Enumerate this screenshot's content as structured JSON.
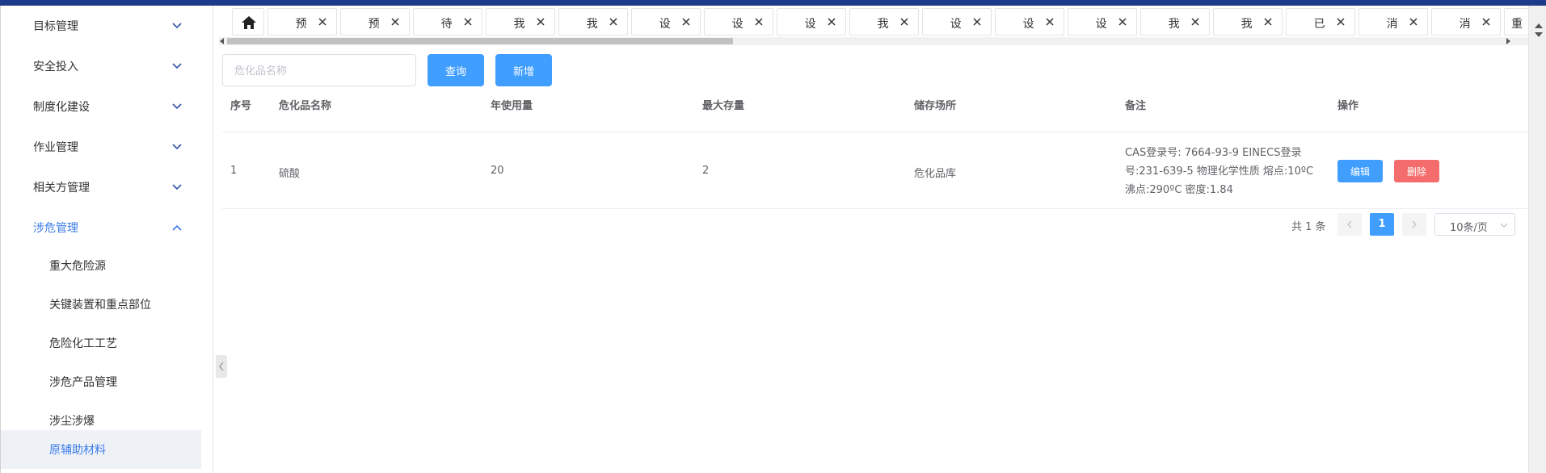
{
  "sidebar": {
    "menus": [
      {
        "label": "目标管理",
        "expanded": false
      },
      {
        "label": "安全投入",
        "expanded": false
      },
      {
        "label": "制度化建设",
        "expanded": false
      },
      {
        "label": "作业管理",
        "expanded": false
      },
      {
        "label": "相关方管理",
        "expanded": false
      },
      {
        "label": "涉危管理",
        "expanded": true
      }
    ],
    "sub_items": [
      {
        "label": "重大危险源"
      },
      {
        "label": "关键装置和重点部位"
      },
      {
        "label": "危险化工工艺"
      },
      {
        "label": "涉危产品管理"
      },
      {
        "label": "涉尘涉爆"
      },
      {
        "label": "原辅助材料",
        "selected": true
      }
    ]
  },
  "tabs": [
    {
      "label": "预"
    },
    {
      "label": "预"
    },
    {
      "label": "待"
    },
    {
      "label": "我"
    },
    {
      "label": "我"
    },
    {
      "label": "设"
    },
    {
      "label": "设"
    },
    {
      "label": "设"
    },
    {
      "label": "我"
    },
    {
      "label": "设"
    },
    {
      "label": "设"
    },
    {
      "label": "设"
    },
    {
      "label": "我"
    },
    {
      "label": "我"
    },
    {
      "label": "已"
    },
    {
      "label": "消"
    },
    {
      "label": "消"
    },
    {
      "label": "重"
    }
  ],
  "toolbar": {
    "search_placeholder": "危化品名称",
    "query_label": "查询",
    "add_label": "新增"
  },
  "table": {
    "columns": [
      "序号",
      "危化品名称",
      "年使用量",
      "最大存量",
      "储存场所",
      "备注",
      "操作"
    ],
    "rows": [
      {
        "index": "1",
        "name": "硫酸",
        "annual_use": "20",
        "max_stock": "2",
        "storage": "危化品库",
        "remark_lines": [
          "CAS登录号: 7664-93-9 EINECS登录",
          "号:231-639-5 物理化学性质 熔点:10ºC",
          "沸点:290ºC 密度:1.84"
        ],
        "edit_label": "编辑",
        "delete_label": "删除"
      }
    ]
  },
  "pager": {
    "total": "共 1 条",
    "current_page": "1",
    "page_size": "10条/页"
  },
  "colors": {
    "accent": "#409eff",
    "danger": "#f56c6c",
    "topbar": "#1e3a8a",
    "active_menu": "#3a7be8"
  }
}
